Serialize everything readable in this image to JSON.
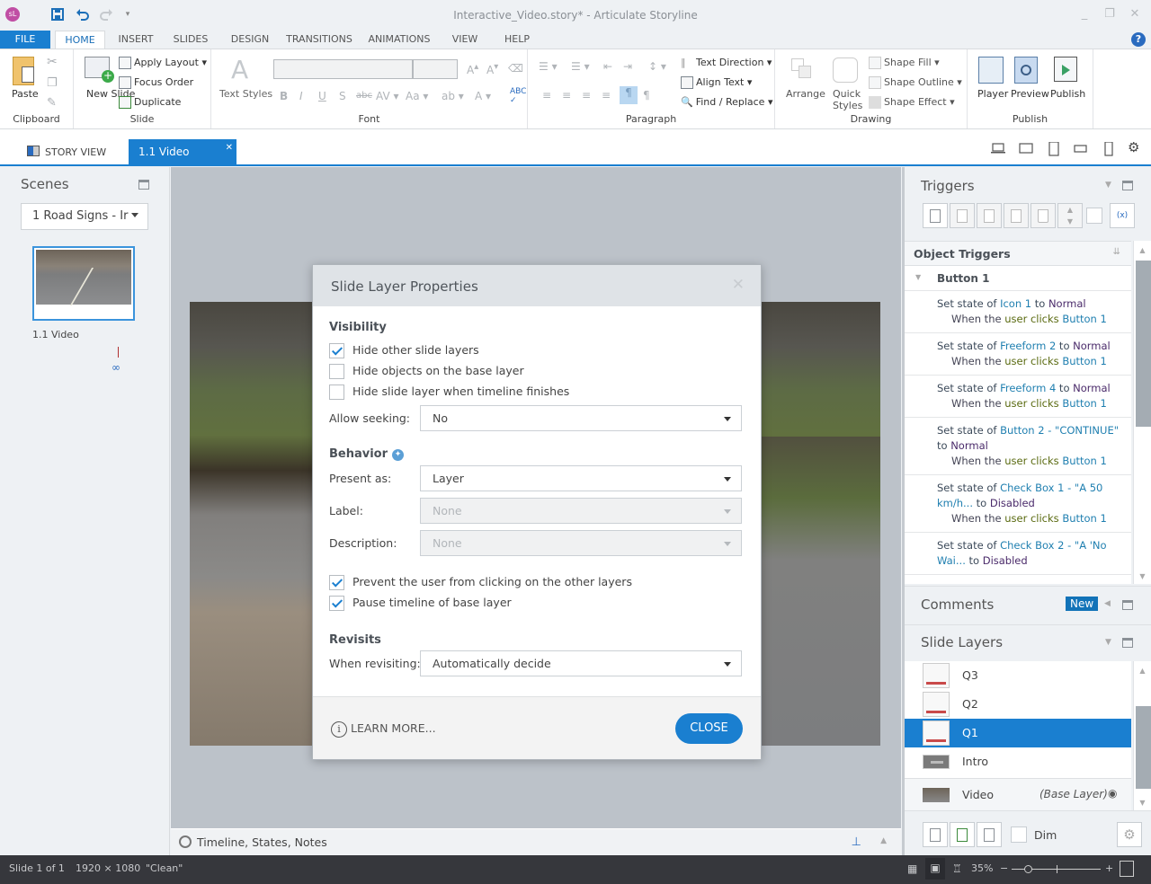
{
  "titlebar": {
    "app_badge": "sL",
    "title": "Interactive_Video.story* -  Articulate Storyline",
    "icons": [
      "save-icon",
      "undo-icon",
      "redo-icon",
      "customize-quick-access-icon"
    ],
    "controls": [
      "minimize-icon",
      "restore-icon",
      "close-icon"
    ]
  },
  "ribbon_tabs": [
    {
      "label": "FILE"
    },
    {
      "label": "HOME",
      "active": true
    },
    {
      "label": "INSERT"
    },
    {
      "label": "SLIDES"
    },
    {
      "label": "DESIGN"
    },
    {
      "label": "TRANSITIONS"
    },
    {
      "label": "ANIMATIONS"
    },
    {
      "label": "VIEW"
    },
    {
      "label": "HELP"
    }
  ],
  "ribbon": {
    "clipboard": {
      "label": "Clipboard",
      "paste": "Paste"
    },
    "slide": {
      "label": "Slide",
      "new_slide": "New Slide",
      "apply_layout": "Apply Layout",
      "focus_order": "Focus Order",
      "duplicate": "Duplicate"
    },
    "font": {
      "label": "Font",
      "text_styles": "Text Styles",
      "font_name": "",
      "font_size": ""
    },
    "paragraph": {
      "label": "Paragraph",
      "text_direction": "Text Direction",
      "align_text": "Align Text",
      "find_replace": "Find / Replace"
    },
    "drawing": {
      "label": "Drawing",
      "arrange": "Arrange",
      "quick_styles": "Quick Styles",
      "shape_fill": "Shape Fill",
      "shape_outline": "Shape Outline",
      "shape_effect": "Shape Effect"
    },
    "publish": {
      "label": "Publish",
      "player": "Player",
      "preview": "Preview",
      "publish": "Publish"
    }
  },
  "view_tabs": {
    "story_view": "STORY VIEW",
    "slide_tab": "1.1 Video"
  },
  "scenes": {
    "title": "Scenes",
    "selected_scene": "1 Road Signs - Ir",
    "slides": [
      {
        "label": "1.1 Video"
      }
    ]
  },
  "dialog": {
    "title": "Slide Layer Properties",
    "visibility": {
      "heading": "Visibility",
      "options": [
        {
          "label": "Hide other slide layers",
          "checked": true
        },
        {
          "label": "Hide objects on the base layer",
          "checked": false
        },
        {
          "label": "Hide slide layer when timeline finishes",
          "checked": false
        }
      ],
      "allow_seeking_label": "Allow seeking:",
      "allow_seeking_value": "No"
    },
    "behavior": {
      "heading": "Behavior",
      "present_as_label": "Present as:",
      "present_as_value": "Layer",
      "label_label": "Label:",
      "label_value": "None",
      "description_label": "Description:",
      "description_value": "None",
      "options": [
        {
          "label": "Prevent the user from clicking on the other layers",
          "checked": true
        },
        {
          "label": "Pause timeline of base layer",
          "checked": true
        }
      ]
    },
    "revisits": {
      "heading": "Revisits",
      "when_revisiting_label": "When revisiting:",
      "when_revisiting_value": "Automatically decide"
    },
    "learn_more": "LEARN MORE...",
    "close": "CLOSE"
  },
  "canvas": {
    "timeline_label": "Timeline, States, Notes"
  },
  "triggers": {
    "title": "Triggers",
    "section": "Object Triggers",
    "group": "Button 1",
    "items": [
      {
        "prefix": "Set state of ",
        "object": "Icon 1",
        "mid": " to ",
        "value": "Normal",
        "when": "When the ",
        "event": "user clicks",
        "target": "Button 1"
      },
      {
        "prefix": "Set state of ",
        "object": "Freeform 2",
        "mid": " to ",
        "value": "Normal",
        "when": "When the ",
        "event": "user clicks",
        "target": "Button 1"
      },
      {
        "prefix": "Set state of ",
        "object": "Freeform 4",
        "mid": " to ",
        "value": "Normal",
        "when": "When the ",
        "event": "user clicks",
        "target": "Button 1"
      },
      {
        "prefix": "Set state of ",
        "object": "Button 2 - \"CONTINUE\"",
        "mid": " to ",
        "value": "Normal",
        "when": "When the ",
        "event": "user clicks",
        "target": "Button 1"
      },
      {
        "prefix": "Set state of ",
        "object": "Check Box 1 - \"A 50 km/h...",
        "mid": " to ",
        "value": "Disabled",
        "when": "When the ",
        "event": "user clicks",
        "target": "Button 1"
      },
      {
        "prefix": "Set state of ",
        "object": "Check Box 2 - \"A 'No Wai...",
        "mid": " to ",
        "value": "Disabled",
        "when": "",
        "event": "",
        "target": ""
      }
    ]
  },
  "comments": {
    "title": "Comments",
    "new_badge": "New"
  },
  "slide_layers": {
    "title": "Slide Layers",
    "layers": [
      {
        "name": "Q3",
        "selected": false
      },
      {
        "name": "Q2",
        "selected": false
      },
      {
        "name": "Q1",
        "selected": true
      },
      {
        "name": "Intro",
        "selected": false
      }
    ],
    "base_layer": {
      "name": "Video",
      "tag": "(Base Layer)"
    },
    "dim_label": "Dim"
  },
  "statusbar": {
    "slide_count": "Slide 1 of 1",
    "dimensions": "1920 × 1080",
    "theme": "\"Clean\"",
    "zoom": "35%"
  },
  "colors": {
    "accent": "#1a7fd0",
    "statusbar_bg": "#36373c"
  }
}
